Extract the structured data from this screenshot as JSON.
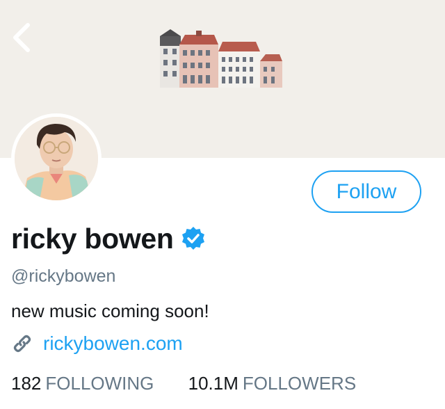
{
  "header": {
    "back_icon": "chevron-left-icon",
    "banner_color": "#f2efea"
  },
  "profile": {
    "name": "ricky bowen",
    "verified_icon": "verified-badge-icon",
    "handle": "@rickybowen",
    "bio": "new music coming soon!",
    "link_icon": "link-icon",
    "link": "rickybowen.com",
    "follow_label": "Follow"
  },
  "stats": {
    "following_count": "182",
    "following_label": "FOLLOWING",
    "followers_count": "10.1M",
    "followers_label": "FOLLOWERS"
  },
  "colors": {
    "accent": "#1da1f2",
    "text": "#14171a",
    "muted": "#657786"
  }
}
